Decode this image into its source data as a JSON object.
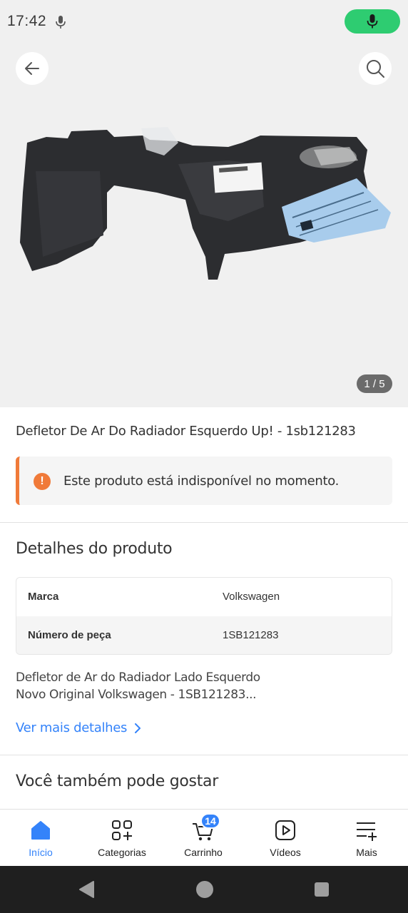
{
  "status_bar": {
    "time": "17:42"
  },
  "gallery": {
    "page_indicator": "1 / 5"
  },
  "product": {
    "title": "Defletor De Ar Do Radiador Esquerdo Up! - 1sb121283",
    "alert": "Este produto está indisponível no momento."
  },
  "details": {
    "title": "Detalhes do produto",
    "rows": [
      {
        "key": "Marca",
        "value": "Volkswagen"
      },
      {
        "key": "Número de peça",
        "value": "1SB121283"
      }
    ],
    "description_line1": "Defletor de Ar do Radiador Lado Esquerdo",
    "description_line2": "Novo Original Volkswagen - 1SB121283...",
    "more_link": "Ver mais detalhes"
  },
  "recommendations": {
    "title": "Você também pode gostar"
  },
  "bottom_nav": {
    "items": [
      {
        "label": "Início",
        "icon": "home-icon",
        "active": true
      },
      {
        "label": "Categorias",
        "icon": "categories-icon"
      },
      {
        "label": "Carrinho",
        "icon": "cart-icon",
        "badge": "14"
      },
      {
        "label": "Vídeos",
        "icon": "video-icon"
      },
      {
        "label": "Mais",
        "icon": "more-icon"
      }
    ]
  },
  "colors": {
    "accent": "#3483fa",
    "warning": "#f07a39",
    "mic": "#2ecc71"
  }
}
